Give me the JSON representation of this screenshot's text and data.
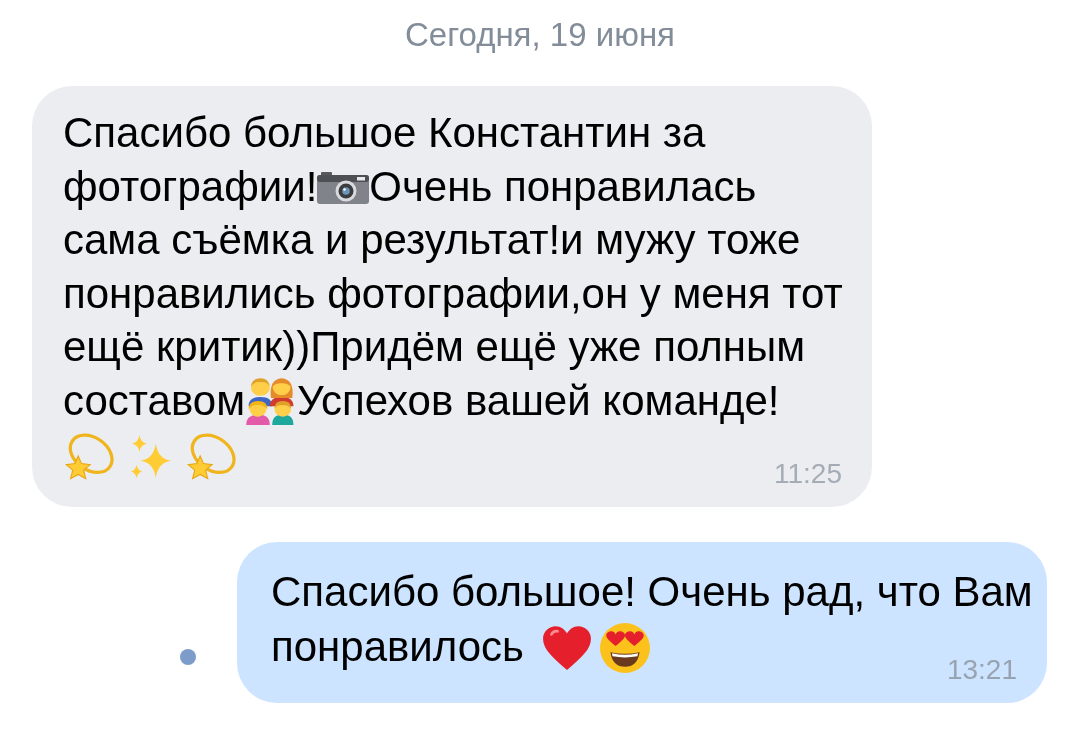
{
  "date_separator": "Сегодня, 19 июня",
  "messages": [
    {
      "kind": "incoming",
      "parts": [
        {
          "kind": "text",
          "text": "Спасибо большое Константин за фотографии!"
        },
        {
          "kind": "camera"
        },
        {
          "kind": "text",
          "text": "Очень понравилась сама съёмка и результат!и мужу тоже понравились фотографии,он у меня тот ещё критик))Придём ещё уже полным составом"
        },
        {
          "kind": "family"
        },
        {
          "kind": "text",
          "text": "Успехов вашей команде!"
        },
        {
          "kind": "dizzy"
        },
        {
          "kind": "sparkles"
        },
        {
          "kind": "dizzy"
        }
      ],
      "time": "11:25",
      "unread": false
    },
    {
      "kind": "outgoing",
      "parts": [
        {
          "kind": "text",
          "text": "Спасибо большое! Очень рад, что Вам понравилось"
        },
        {
          "kind": "heart"
        },
        {
          "kind": "hearteyes"
        }
      ],
      "time": "13:21",
      "unread": true
    }
  ]
}
